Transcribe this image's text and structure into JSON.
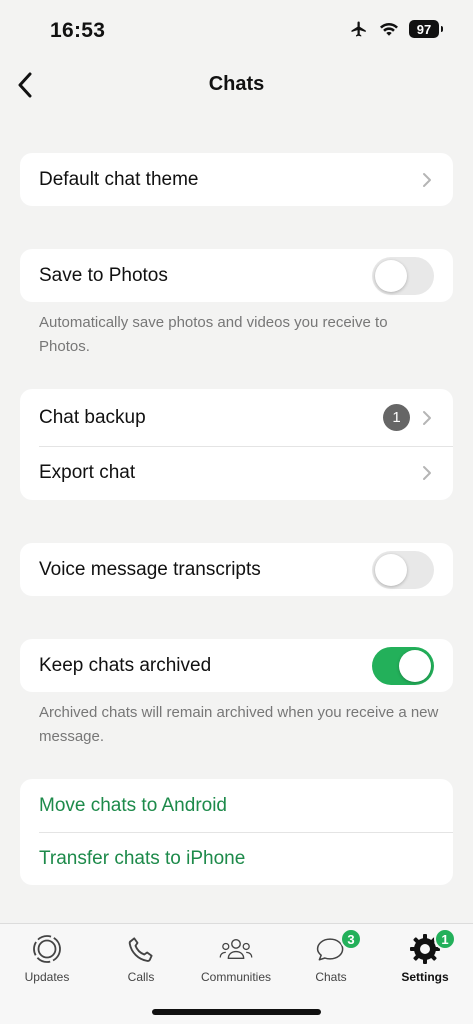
{
  "status": {
    "time": "16:53",
    "battery": "97"
  },
  "nav": {
    "title": "Chats"
  },
  "sections": {
    "theme": {
      "label": "Default chat theme"
    },
    "save_photos": {
      "label": "Save to Photos",
      "enabled": false,
      "note": "Automatically save photos and videos you receive to Photos."
    },
    "backup": {
      "label": "Chat backup",
      "badge": "1"
    },
    "export": {
      "label": "Export chat"
    },
    "transcripts": {
      "label": "Voice message transcripts",
      "enabled": false
    },
    "archived": {
      "label": "Keep chats archived",
      "enabled": true,
      "note": "Archived chats will remain archived when you receive a new message."
    },
    "move_android": {
      "label": "Move chats to Android"
    },
    "transfer_iphone": {
      "label": "Transfer chats to iPhone"
    }
  },
  "tabs": [
    {
      "label": "Updates",
      "icon": "updates-icon"
    },
    {
      "label": "Calls",
      "icon": "phone-icon"
    },
    {
      "label": "Communities",
      "icon": "communities-icon"
    },
    {
      "label": "Chats",
      "icon": "chat-bubble-icon",
      "badge": "3"
    },
    {
      "label": "Settings",
      "icon": "gear-icon",
      "badge": "1",
      "active": true
    }
  ],
  "colors": {
    "accent_green": "#23b05a",
    "link_green": "#1d8a4a",
    "background": "#f3f3f2"
  }
}
